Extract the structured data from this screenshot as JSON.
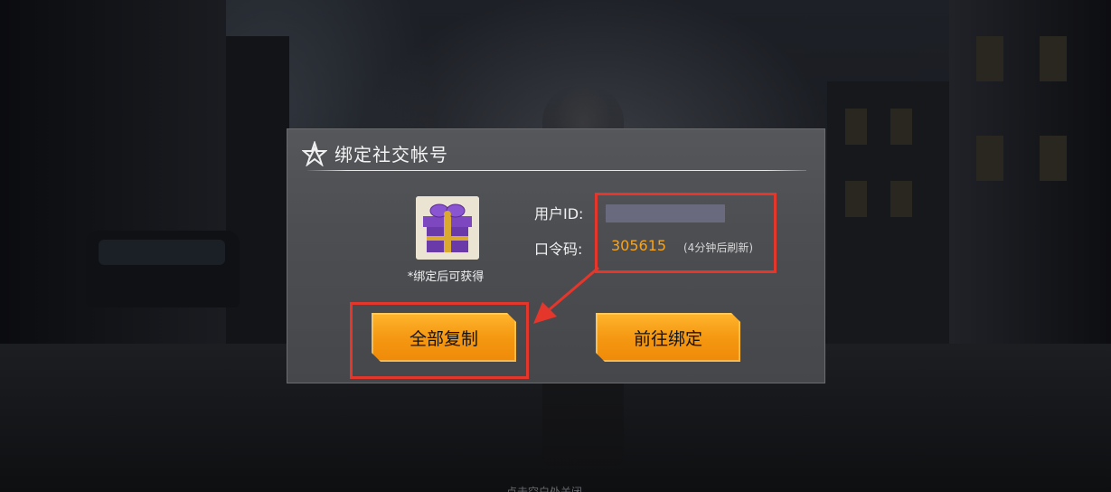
{
  "dialog": {
    "title": "绑定社交帐号",
    "gift_caption": "*绑定后可获得",
    "user_id_label": "用户ID:",
    "code_label": "口令码:",
    "code_value": "305615",
    "code_note": "(4分钟后刷新)",
    "copy_all_label": "全部复制",
    "go_bind_label": "前往绑定"
  },
  "background": {
    "hint": "点击空白处关闭"
  },
  "colors": {
    "accent": "#f5a521",
    "button": "#f59812",
    "annotation": "#e5362c"
  },
  "icons": [
    "star-logo-icon",
    "gift-box-icon",
    "red-arrow-icon"
  ]
}
